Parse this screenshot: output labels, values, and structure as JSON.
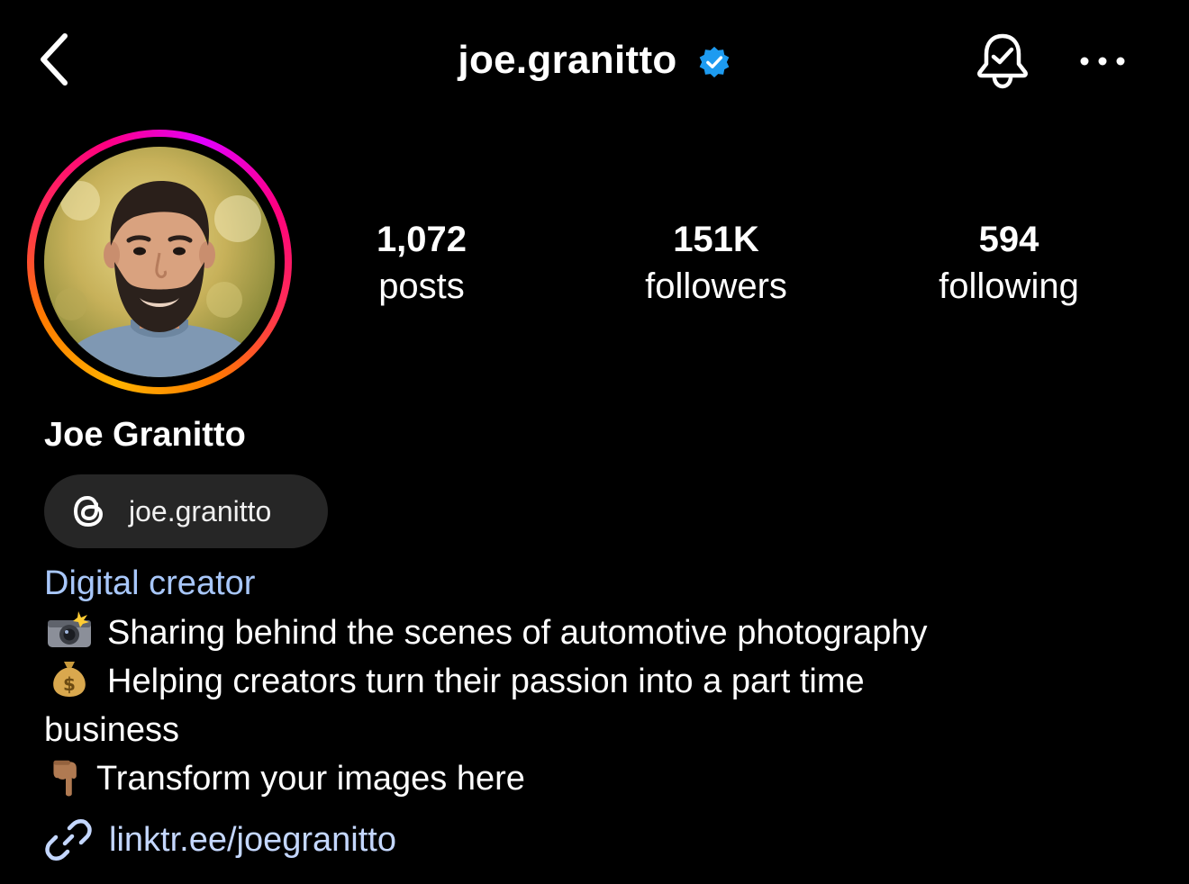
{
  "header": {
    "username": "joe.granitto",
    "verified": true,
    "back_icon": "chevron-left-icon",
    "bell_icon": "bell-check-icon",
    "more_icon": "more-horizontal-icon"
  },
  "stats": [
    {
      "value": "1,072",
      "label": "posts"
    },
    {
      "value": "151K",
      "label": "followers"
    },
    {
      "value": "594",
      "label": "following"
    }
  ],
  "profile": {
    "display_name": "Joe Granitto",
    "threads_handle": "joe.granitto",
    "category": "Digital creator",
    "bio": {
      "line1": "Sharing behind the scenes of automotive photography",
      "line2": "Helping creators turn their passion into a part time",
      "line3": "business",
      "line4": "Transform your images here"
    },
    "link": "linktr.ee/joegranitto"
  },
  "colors": {
    "background": "#000000",
    "text": "#ffffff",
    "category": "#a8c7fa",
    "link": "#c4d7ff",
    "pill": "#262626",
    "verified": "#1d9bf0"
  }
}
